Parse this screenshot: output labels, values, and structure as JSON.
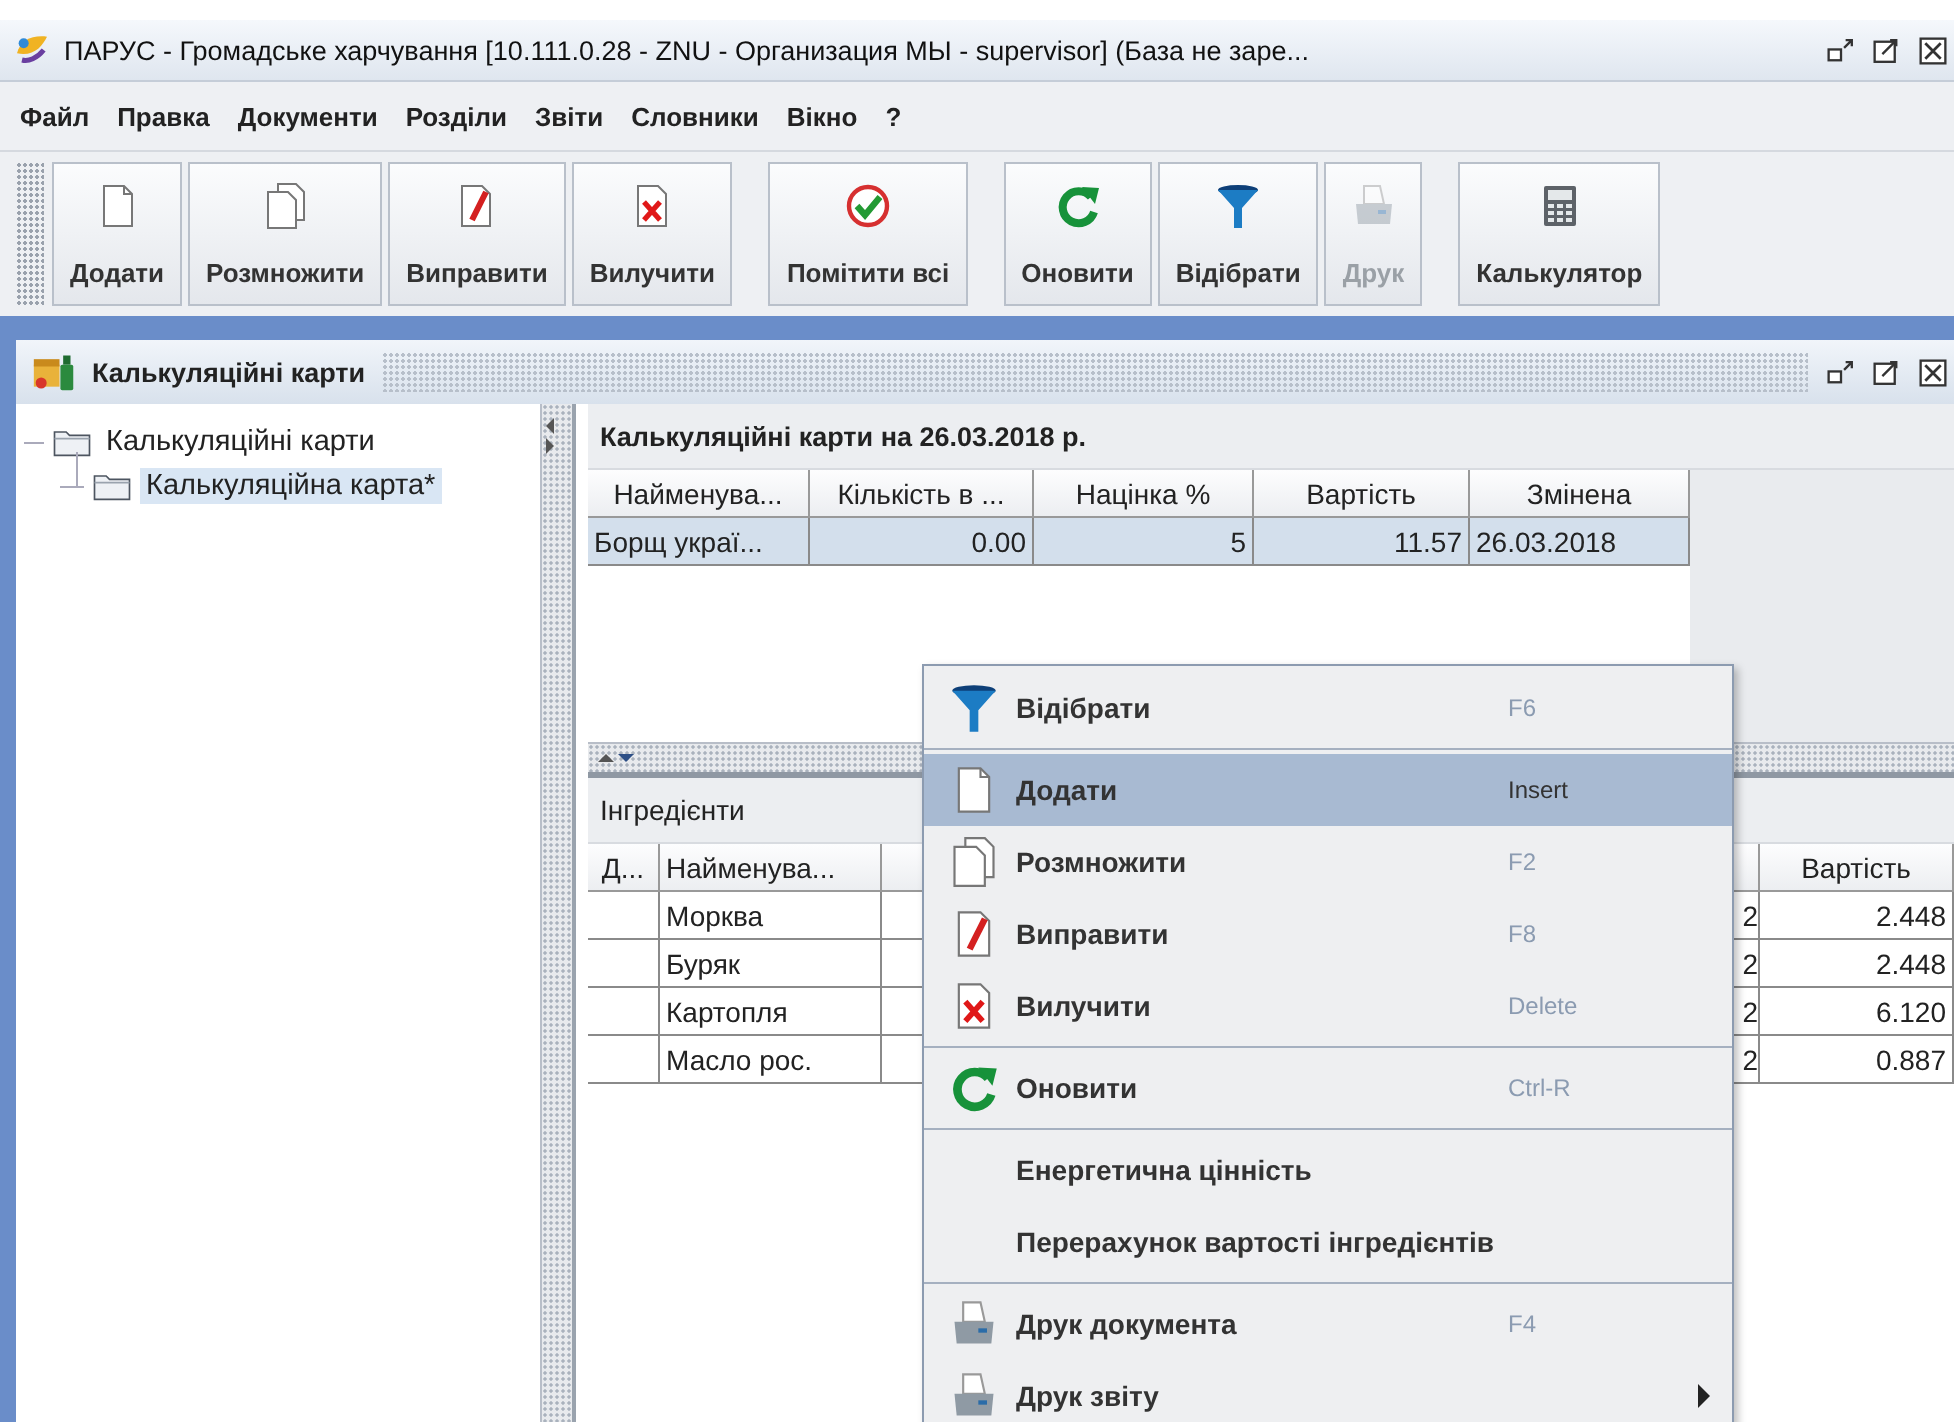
{
  "window": {
    "title": "ПАРУС - Громадське харчування [10.111.0.28 - ZNU - Организация МЫ - supervisor] (База не заре..."
  },
  "menu_bar": [
    "Файл",
    "Правка",
    "Документи",
    "Розділи",
    "Звіти",
    "Словники",
    "Вікно",
    "?"
  ],
  "toolbar": {
    "groups": [
      {
        "buttons": [
          {
            "label": "Додати",
            "kind": "document",
            "disabled": false
          },
          {
            "label": "Розмножити",
            "kind": "copies",
            "disabled": false
          },
          {
            "label": "Виправити",
            "kind": "edit",
            "disabled": false
          },
          {
            "label": "Вилучити",
            "kind": "delete",
            "disabled": false
          }
        ]
      },
      {
        "buttons": [
          {
            "label": "Помітити всі",
            "kind": "check",
            "disabled": false
          }
        ]
      },
      {
        "buttons": [
          {
            "label": "Оновити",
            "kind": "refresh",
            "disabled": false
          },
          {
            "label": "Відібрати",
            "kind": "filter",
            "disabled": false
          },
          {
            "label": "Друк",
            "kind": "print",
            "disabled": true
          }
        ]
      },
      {
        "buttons": [
          {
            "label": "Калькулятор",
            "kind": "calculator",
            "disabled": false
          }
        ]
      }
    ]
  },
  "frame": {
    "title": "Калькуляційні карти"
  },
  "tree": [
    {
      "label": "Калькуляційні карти",
      "selected": false,
      "children": [
        {
          "label": "Калькуляційна карта*",
          "selected": true
        }
      ]
    }
  ],
  "cards": {
    "title": "Калькуляційні карти на 26.03.2018 р.",
    "columns": [
      "Найменува...",
      "Кількість в ...",
      "Націнка %",
      "Вартість",
      "Змінена"
    ],
    "rows": [
      {
        "cells": [
          "Борщ украї...",
          "0.00",
          "5",
          "11.57",
          "26.03.2018"
        ],
        "selected": true
      }
    ]
  },
  "ingredients": {
    "title": "Інгредієнти",
    "columns": {
      "column_1": "Д...",
      "name": "Найменува...",
      "cost": "Вартість"
    },
    "rows": [
      {
        "name": "Морква",
        "column_4": "2",
        "cost": "2.448",
        "selected": false
      },
      {
        "name": "Буряк",
        "column_4": "2",
        "cost": "2.448",
        "selected": false
      },
      {
        "name": "Картопля",
        "column_4": "2",
        "cost": "6.120",
        "selected": false
      },
      {
        "name": "Масло рос.",
        "column_4": "2",
        "cost": "0.887",
        "selected": false
      }
    ]
  },
  "context_menu": {
    "groups": [
      {
        "items": [
          {
            "kind": "filter",
            "label": "Відібрати",
            "shortcut": "F6",
            "selected": false,
            "submenu": false
          }
        ]
      },
      {
        "items": [
          {
            "kind": "document",
            "label": "Додати",
            "shortcut": "Insert",
            "selected": true,
            "submenu": false
          },
          {
            "kind": "copies",
            "label": "Розмножити",
            "shortcut": "F2",
            "selected": false,
            "submenu": false
          },
          {
            "kind": "edit",
            "label": "Виправити",
            "shortcut": "F8",
            "selected": false,
            "submenu": false
          },
          {
            "kind": "delete",
            "label": "Вилучити",
            "shortcut": "Delete",
            "selected": false,
            "submenu": false
          }
        ]
      },
      {
        "items": [
          {
            "kind": "refresh",
            "label": "Оновити",
            "shortcut": "Ctrl-R",
            "selected": false,
            "submenu": false
          }
        ]
      },
      {
        "items": [
          {
            "kind": "plain",
            "label": "Енергетична цінність",
            "selected": false,
            "submenu": false
          },
          {
            "kind": "plain",
            "label": "Перерахунок вартості інгредієнтів",
            "selected": false,
            "submenu": false
          }
        ]
      },
      {
        "items": [
          {
            "kind": "print",
            "label": "Друк документа",
            "shortcut": "F4",
            "selected": false,
            "submenu": false
          },
          {
            "kind": "print",
            "label": "Друк звіту",
            "selected": false,
            "submenu": true
          }
        ]
      }
    ]
  }
}
